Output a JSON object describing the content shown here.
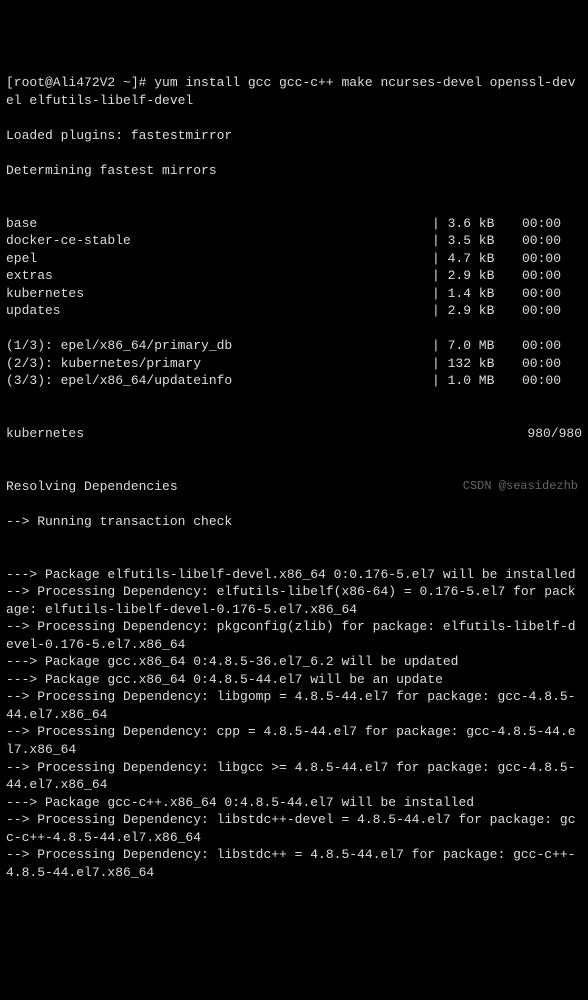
{
  "prompt": "[root@Ali472V2 ~]# yum install gcc gcc-c++ make ncurses-devel openssl-devel elfutils-libelf-devel",
  "msg_loaded": "Loaded plugins: fastestmirror",
  "msg_determining": "Determining fastest mirrors",
  "repos": [
    {
      "name": "base",
      "size": "| 3.6 kB",
      "time": "00:00"
    },
    {
      "name": "docker-ce-stable",
      "size": "| 3.5 kB",
      "time": "00:00"
    },
    {
      "name": "epel",
      "size": "| 4.7 kB",
      "time": "00:00"
    },
    {
      "name": "extras",
      "size": "| 2.9 kB",
      "time": "00:00"
    },
    {
      "name": "kubernetes",
      "size": "| 1.4 kB",
      "time": "00:00"
    },
    {
      "name": "updates",
      "size": "| 2.9 kB",
      "time": "00:00"
    }
  ],
  "downloads": [
    {
      "name": "(1/3): epel/x86_64/primary_db",
      "size": "| 7.0 MB",
      "time": "00:00"
    },
    {
      "name": "(2/3): kubernetes/primary",
      "size": "| 132 kB",
      "time": "00:00"
    },
    {
      "name": "(3/3): epel/x86_64/updateinfo",
      "size": "| 1.0 MB",
      "time": "00:00"
    }
  ],
  "kube_count_line": {
    "name": "kubernetes",
    "count": "980/980"
  },
  "msg_resolving": "Resolving Dependencies",
  "msg_transcheck": "--> Running transaction check",
  "dep_lines": [
    "---> Package elfutils-libelf-devel.x86_64 0:0.176-5.el7 will be installed",
    "--> Processing Dependency: elfutils-libelf(x86-64) = 0.176-5.el7 for package: elfutils-libelf-devel-0.176-5.el7.x86_64",
    "--> Processing Dependency: pkgconfig(zlib) for package: elfutils-libelf-devel-0.176-5.el7.x86_64",
    "---> Package gcc.x86_64 0:4.8.5-36.el7_6.2 will be updated",
    "---> Package gcc.x86_64 0:4.8.5-44.el7 will be an update",
    "--> Processing Dependency: libgomp = 4.8.5-44.el7 for package: gcc-4.8.5-44.el7.x86_64",
    "--> Processing Dependency: cpp = 4.8.5-44.el7 for package: gcc-4.8.5-44.el7.x86_64",
    "--> Processing Dependency: libgcc >= 4.8.5-44.el7 for package: gcc-4.8.5-44.el7.x86_64",
    "---> Package gcc-c++.x86_64 0:4.8.5-44.el7 will be installed",
    "--> Processing Dependency: libstdc++-devel = 4.8.5-44.el7 for package: gcc-c++-4.8.5-44.el7.x86_64",
    "--> Processing Dependency: libstdc++ = 4.8.5-44.el7 for package: gcc-c++-4.8.5-44.el7.x86_64"
  ],
  "watermark": "CSDN @seasidezhb"
}
